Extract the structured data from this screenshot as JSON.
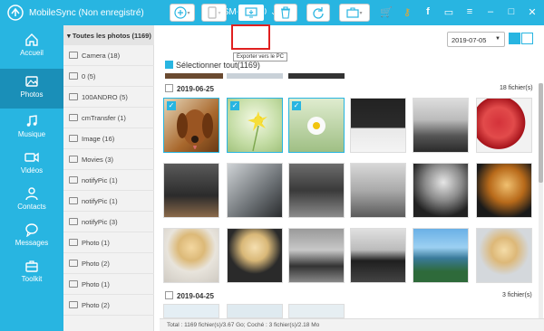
{
  "titlebar": {
    "app_title": "MobileSync (Non enregistré)",
    "device": "SM-G9350",
    "icons": [
      "cart-icon",
      "key-icon",
      "facebook-icon",
      "feedback-icon",
      "menu-icon",
      "minimize-icon",
      "maximize-icon",
      "close-icon"
    ]
  },
  "nav": {
    "items": [
      {
        "label": "Accueil",
        "icon": "home-icon"
      },
      {
        "label": "Photos",
        "icon": "photo-icon"
      },
      {
        "label": "Musique",
        "icon": "music-icon"
      },
      {
        "label": "Vidéos",
        "icon": "video-icon"
      },
      {
        "label": "Contacts",
        "icon": "contacts-icon"
      },
      {
        "label": "Messages",
        "icon": "messages-icon"
      },
      {
        "label": "Toolkit",
        "icon": "toolkit-icon"
      }
    ],
    "active": "Photos"
  },
  "folders": {
    "header": "Toutes les photos (1169)",
    "items": [
      "Camera (18)",
      "0 (5)",
      "100ANDRO (5)",
      "cmTransfer (1)",
      "Image (16)",
      "Movies (3)",
      "notifyPic (1)",
      "notifyPic (1)",
      "notifyPic (3)",
      "Photo (1)",
      "Photo (2)",
      "Photo (1)",
      "Photo (2)"
    ]
  },
  "toolbar": {
    "tooltip": "Exporter vers le PC",
    "date": "2019-07-05"
  },
  "content": {
    "select_all": "Sélectionner tout(1169)",
    "groups": [
      {
        "date": "2019-06-25",
        "count": "18 fichier(s)"
      },
      {
        "date": "2019-04-25",
        "count": "3 fichier(s)"
      }
    ]
  },
  "status": "Total : 1169 fichier(s)/3.67 Go; Coché : 3 fichier(s)/2.18 Mo",
  "colors": {
    "accent": "#28b5e1",
    "active_nav": "#1a8fb8",
    "highlight": "#e02020"
  }
}
